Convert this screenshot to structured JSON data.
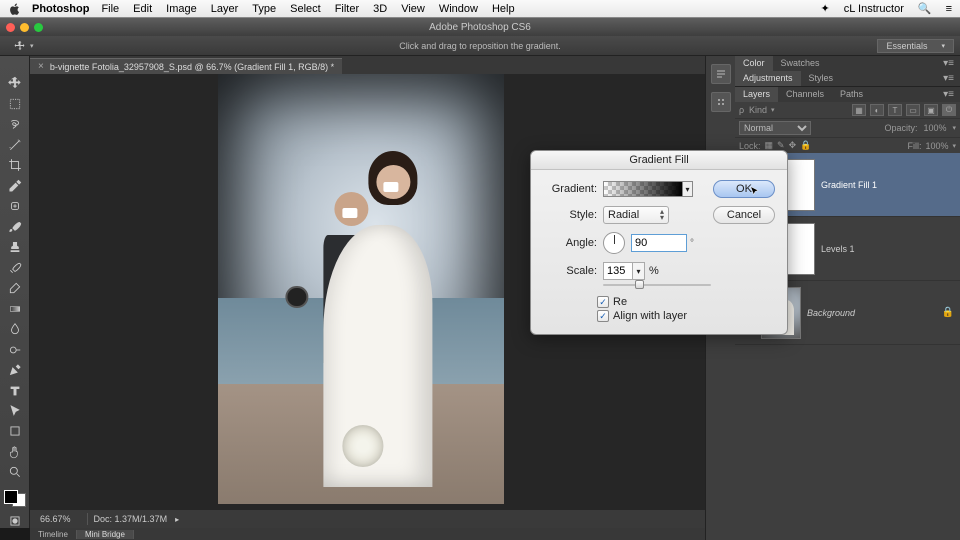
{
  "menubar": {
    "app": "Photoshop",
    "items": [
      "File",
      "Edit",
      "Image",
      "Layer",
      "Type",
      "Select",
      "Filter",
      "3D",
      "View",
      "Window",
      "Help"
    ],
    "user": "cL Instructor"
  },
  "window": {
    "title": "Adobe Photoshop CS6"
  },
  "options": {
    "hint": "Click and drag to reposition the gradient.",
    "workspace": "Essentials"
  },
  "doc_tab": "b-vignette Fotolia_32957908_S.psd @ 66.7% (Gradient Fill 1, RGB/8) *",
  "status": {
    "zoom": "66.67%",
    "doc": "Doc: 1.37M/1.37M"
  },
  "bottom_tabs": [
    "Timeline",
    "Mini Bridge"
  ],
  "panels": {
    "color_tabs": [
      "Color",
      "Swatches"
    ],
    "adjust_tabs": [
      "Adjustments",
      "Styles"
    ],
    "layer_tabs": [
      "Layers",
      "Channels",
      "Paths"
    ],
    "kind_label": "Kind",
    "blend_mode": "Normal",
    "opacity_label": "Opacity:",
    "opacity_value": "100%",
    "lock_label": "Lock:",
    "fill_label": "Fill:",
    "fill_value": "100%",
    "layers": [
      {
        "name": "Gradient Fill 1"
      },
      {
        "name": "Levels 1"
      },
      {
        "name": "Background"
      }
    ]
  },
  "dialog": {
    "title": "Gradient Fill",
    "gradient_label": "Gradient:",
    "style_label": "Style:",
    "style_value": "Radial",
    "angle_label": "Angle:",
    "angle_value": "90",
    "scale_label": "Scale:",
    "scale_value": "135",
    "scale_unit": "%",
    "reverse_label": "Re",
    "align_label": "Align with layer",
    "ok": "OK",
    "cancel": "Cancel"
  }
}
